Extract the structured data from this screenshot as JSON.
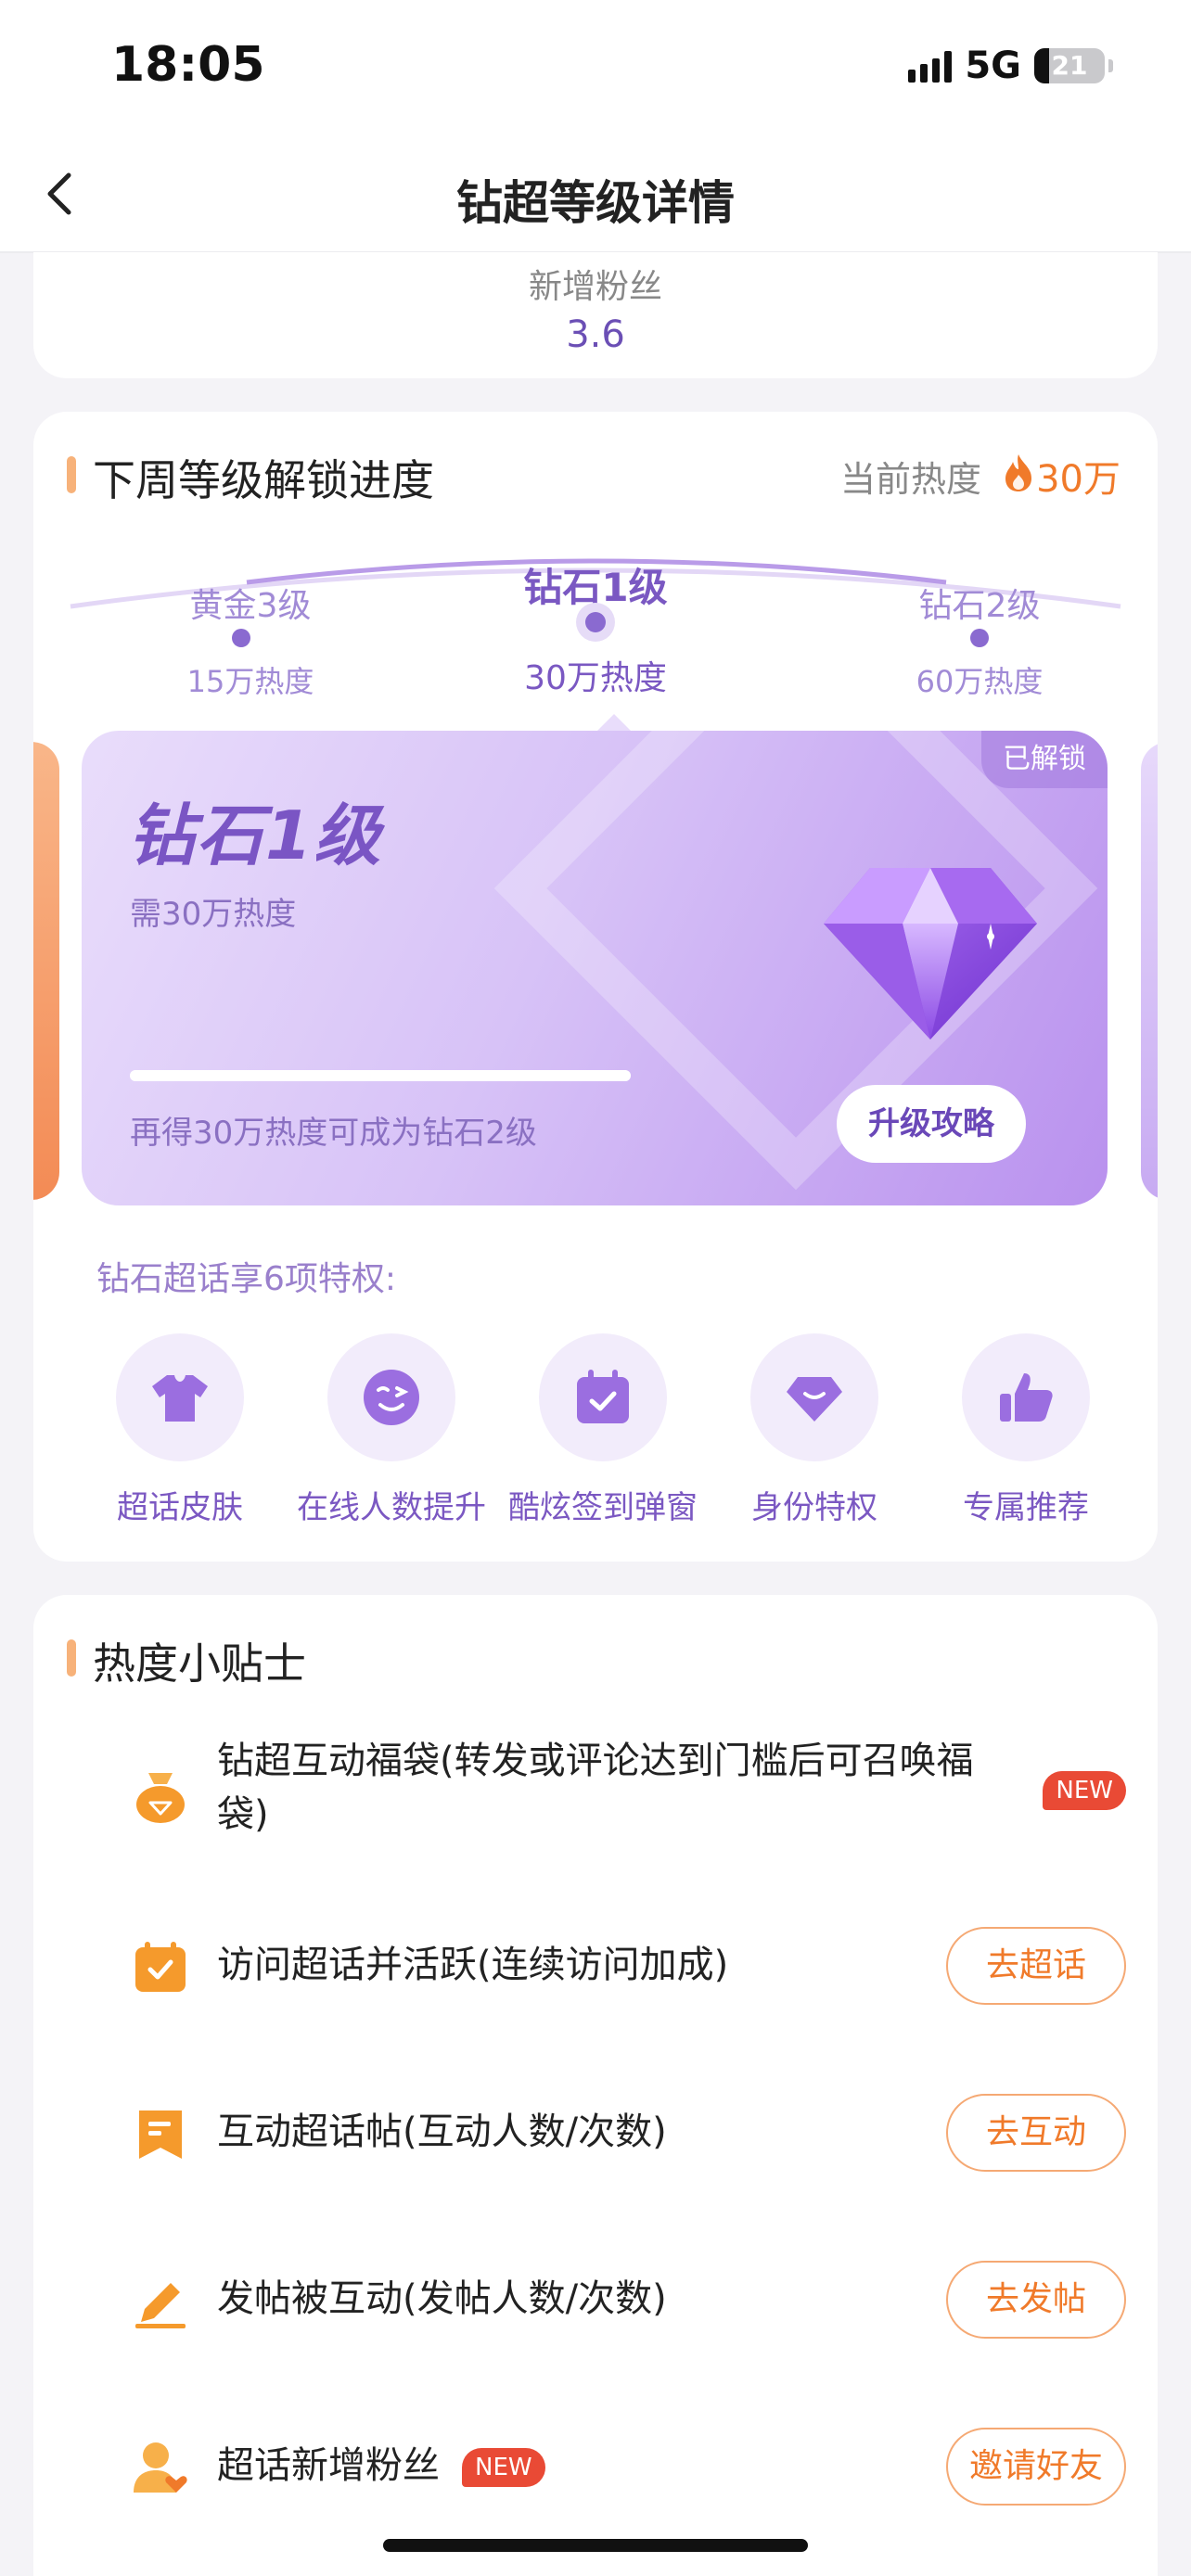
{
  "status_bar": {
    "time": "18:05",
    "network": "5G",
    "battery": "21",
    "battery_level": 0.21
  },
  "header": {
    "title": "钻超等级详情"
  },
  "summary": {
    "fans_label": "新增粉丝",
    "fans_value": "3.6"
  },
  "level_section": {
    "title": "下周等级解锁进度",
    "heat_label": "当前热度",
    "heat_value": "30万",
    "levels": [
      {
        "name": "黄金3级",
        "heat": "15万热度",
        "current": false
      },
      {
        "name": "钻石1级",
        "heat": "30万热度",
        "current": true
      },
      {
        "name": "钻石2级",
        "heat": "60万热度",
        "current": false
      }
    ],
    "card": {
      "badge": "已解锁",
      "name": "钻石1级",
      "need": "需30万热度",
      "progress": 1.0,
      "progress_text": "再得30万热度可成为钻石2级",
      "guide_button": "升级攻略"
    },
    "privilege_title": "钻石超话享6项特权:",
    "privileges": [
      {
        "label": "超话皮肤",
        "icon": "tshirt-icon"
      },
      {
        "label": "在线人数提升",
        "icon": "smiley-icon"
      },
      {
        "label": "酷炫签到弹窗",
        "icon": "calendar-check-icon"
      },
      {
        "label": "身份特权",
        "icon": "diamond-icon"
      },
      {
        "label": "专属推荐",
        "icon": "thumbs-up-icon"
      }
    ]
  },
  "tips_section": {
    "title": "热度小贴士",
    "tips": [
      {
        "text_line1": "钻超互动福袋(转发或评论达到门槛后可召唤福",
        "text_line2": "袋)",
        "badge": "NEW",
        "icon": "lucky-bag-icon"
      },
      {
        "text": "访问超话并活跃(连续访问加成)",
        "button": "去超话",
        "icon": "calendar-check-icon"
      },
      {
        "text": "互动超话帖(互动人数/次数)",
        "button": "去互动",
        "icon": "bookmark-icon"
      },
      {
        "text": "发帖被互动(发帖人数/次数)",
        "button": "去发帖",
        "icon": "pencil-icon"
      },
      {
        "text": "超话新增粉丝",
        "badge": "NEW",
        "button": "邀请好友",
        "icon": "user-heart-icon"
      }
    ]
  },
  "colors": {
    "accent_purple": "#7a58c2",
    "accent_orange": "#f07a2a",
    "new_red": "#e94a35"
  }
}
